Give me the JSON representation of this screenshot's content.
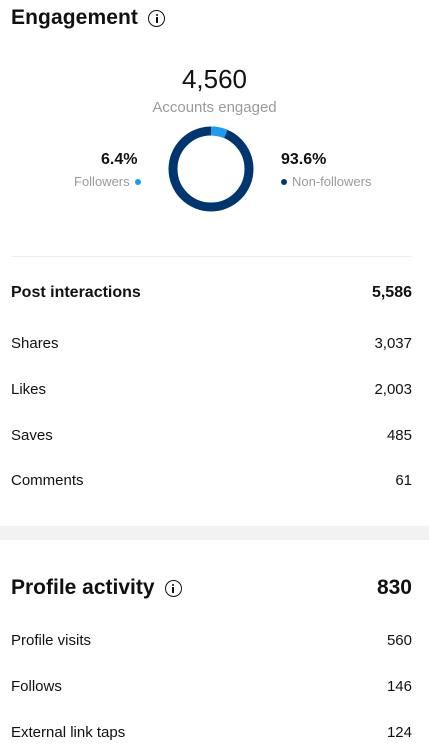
{
  "engagement": {
    "title": "Engagement",
    "accounts_engaged_value": "4,560",
    "accounts_engaged_label": "Accounts engaged",
    "followers": {
      "percent": "6.4%",
      "label": "Followers",
      "fraction": 0.064,
      "color": "#1e9bf0"
    },
    "non_followers": {
      "percent": "93.6%",
      "label": "Non-followers",
      "fraction": 0.936,
      "color": "#003670"
    }
  },
  "post_interactions": {
    "title": "Post interactions",
    "total": "5,586",
    "items": [
      {
        "label": "Shares",
        "value": "3,037"
      },
      {
        "label": "Likes",
        "value": "2,003"
      },
      {
        "label": "Saves",
        "value": "485"
      },
      {
        "label": "Comments",
        "value": "61"
      }
    ]
  },
  "profile_activity": {
    "title": "Profile activity",
    "total": "830",
    "items": [
      {
        "label": "Profile visits",
        "value": "560"
      },
      {
        "label": "Follows",
        "value": "146"
      },
      {
        "label": "External link taps",
        "value": "124"
      }
    ]
  }
}
